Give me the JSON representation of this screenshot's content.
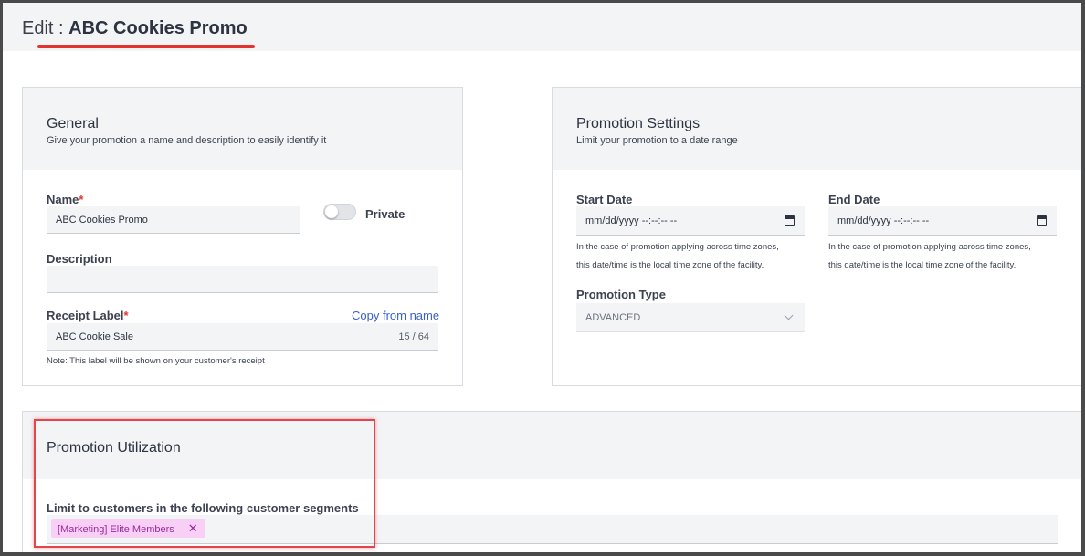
{
  "header": {
    "title_prefix": "Edit : ",
    "title_name": "ABC Cookies Promo"
  },
  "general": {
    "title": "General",
    "subtitle": "Give your promotion a name and description to easily identify it",
    "name_label": "Name",
    "name_value": "ABC Cookies Promo",
    "private_label": "Private",
    "description_label": "Description",
    "description_value": "",
    "receipt_label": "Receipt Label",
    "copy_from_name": "Copy from name",
    "receipt_value": "ABC Cookie Sale",
    "receipt_counter": "15 / 64",
    "receipt_note": "Note: This label will be shown on your customer's receipt",
    "required_mark": "*"
  },
  "settings": {
    "title": "Promotion Settings",
    "subtitle": "Limit your promotion to a date range",
    "start_label": "Start Date",
    "end_label": "End Date",
    "date_placeholder": "mm/dd/yyyy --:--:-- --",
    "tz_note_line1": "In the case of promotion applying across time zones,",
    "tz_note_line2": "this date/time is the local time zone of the facility.",
    "type_label": "Promotion Type",
    "type_value": "ADVANCED"
  },
  "utilization": {
    "title": "Promotion Utilization",
    "segments_label": "Limit to customers in the following customer segments",
    "chips": [
      "[Marketing] Elite Members"
    ],
    "chip_remove": "✕"
  },
  "colors": {
    "accent_red": "#e3342f",
    "chip_bg": "#f8cff5",
    "chip_text": "#9b2aa0",
    "link_blue": "#3a5fcd"
  }
}
